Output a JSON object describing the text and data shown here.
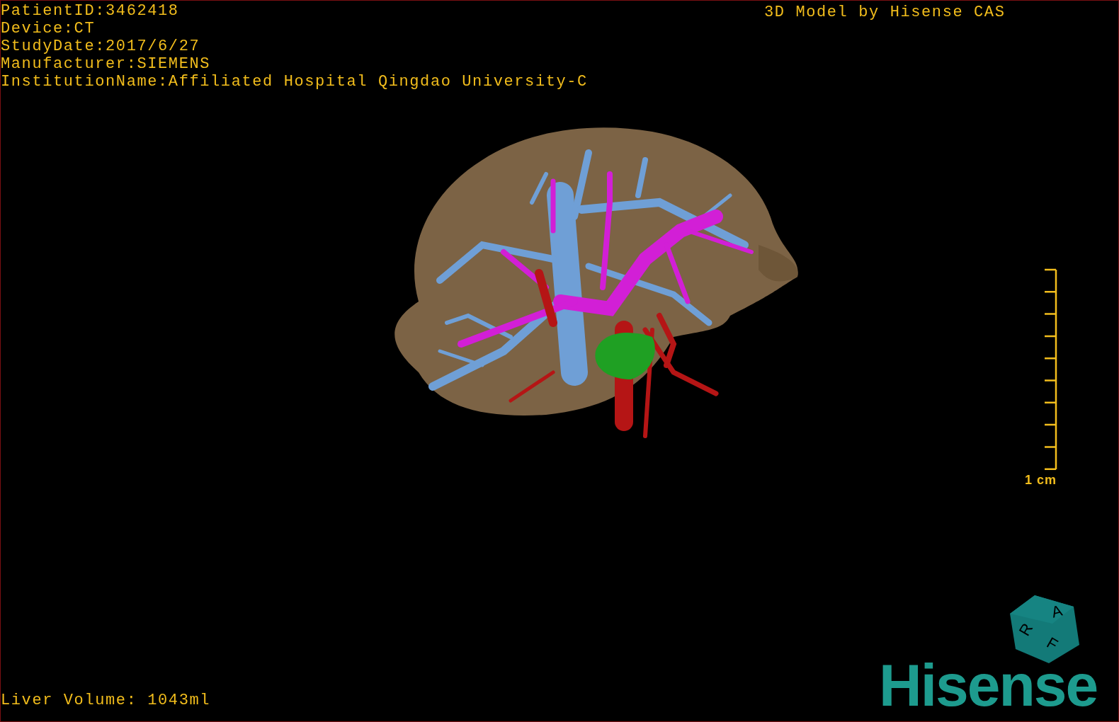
{
  "info_lines": [
    "PatientID:3462418",
    "Device:CT",
    "StudyDate:2017/6/27",
    "Manufacturer:SIEMENS",
    "InstitutionName:Affiliated Hospital Qingdao University-C"
  ],
  "title": "3D Model by Hisense CAS",
  "scale_label": "1 cm",
  "volume": "Liver Volume: 1043ml",
  "orientation_cube": {
    "labels": [
      "R",
      "A",
      "F"
    ]
  },
  "logo": "Hisense"
}
